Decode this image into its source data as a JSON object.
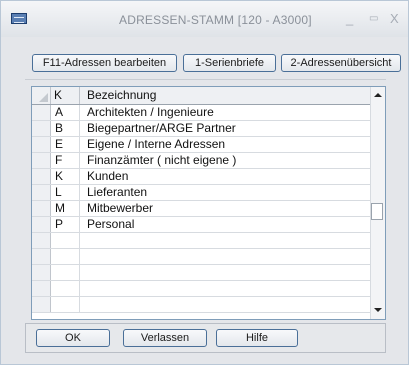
{
  "window": {
    "title": "ADRESSEN-STAMM  [120 - A3000]",
    "minimize_glyph": "_",
    "maximize_glyph": "▭",
    "close_glyph": "X"
  },
  "toolbar": {
    "edit_addresses_label": "F11-Adressen bearbeiten",
    "serial_letters_label": "1-Serienbriefe",
    "address_overview_label": "2-Adressenübersicht"
  },
  "grid": {
    "columns": [
      "K",
      "Bezeichnung"
    ],
    "rows": [
      {
        "k": "A",
        "name": "Architekten / Ingenieure"
      },
      {
        "k": "B",
        "name": "Biegepartner/ARGE Partner"
      },
      {
        "k": "E",
        "name": "Eigene / Interne Adressen"
      },
      {
        "k": "F",
        "name": "Finanzämter ( nicht eigene )"
      },
      {
        "k": "K",
        "name": "Kunden"
      },
      {
        "k": "L",
        "name": "Lieferanten"
      },
      {
        "k": "M",
        "name": "Mitbewerber"
      },
      {
        "k": "P",
        "name": "Personal"
      },
      {
        "k": "",
        "name": ""
      },
      {
        "k": "",
        "name": ""
      },
      {
        "k": "",
        "name": ""
      },
      {
        "k": "",
        "name": ""
      },
      {
        "k": "",
        "name": ""
      }
    ]
  },
  "footer": {
    "ok_label": "OK",
    "leave_label": "Verlassen",
    "help_label": "Hilfe"
  },
  "icons": {
    "app": "table-window-icon",
    "scroll_up": "arrow-up-icon",
    "scroll_down": "arrow-down-icon"
  },
  "colors": {
    "button_border": "#4a6f98",
    "title_text": "#8a9099",
    "grid_border": "#7f9db9"
  }
}
